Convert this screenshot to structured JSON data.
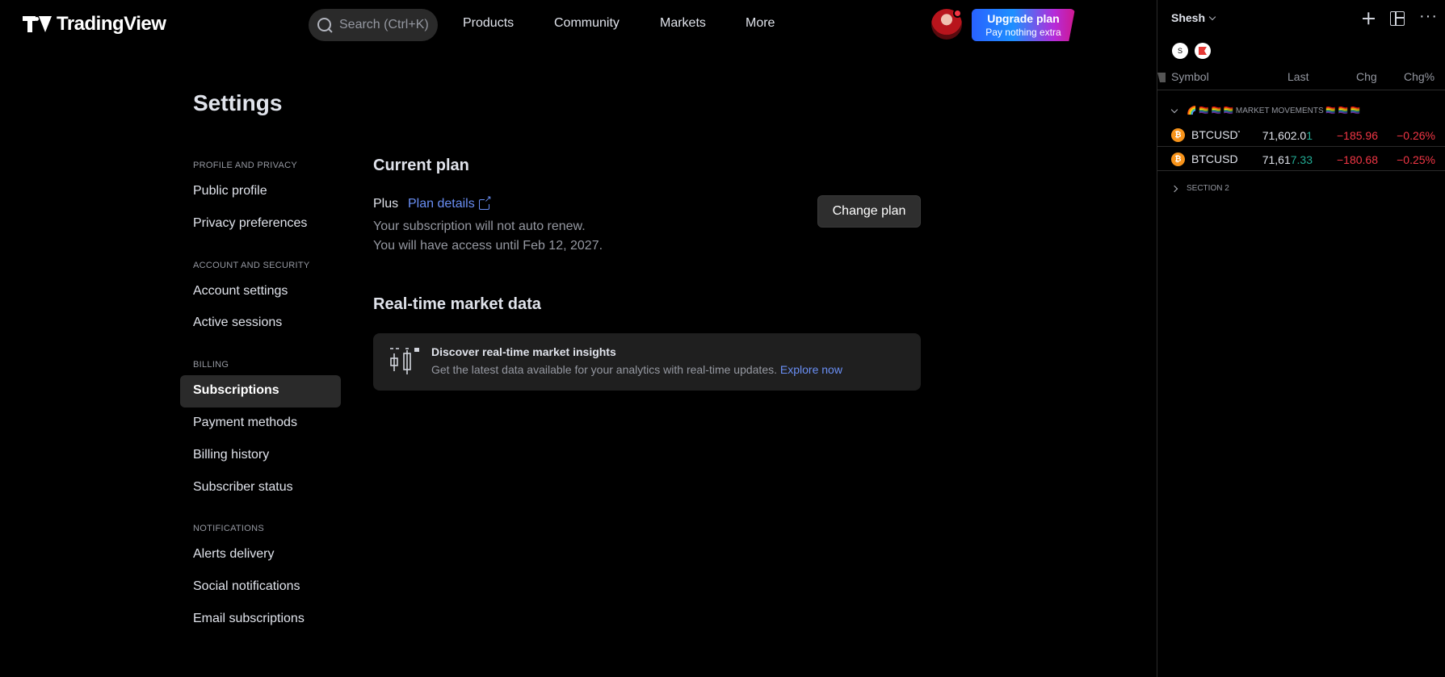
{
  "header": {
    "logo_text": "TradingView",
    "search_placeholder": "Search (Ctrl+K)",
    "nav": [
      "Products",
      "Community",
      "Markets",
      "More"
    ],
    "upgrade_title": "Upgrade plan",
    "upgrade_subtitle": "Pay nothing extra"
  },
  "settings_nav": {
    "title": "Settings",
    "sections": [
      {
        "heading": "PROFILE AND PRIVACY",
        "items": [
          "Public profile",
          "Privacy preferences"
        ]
      },
      {
        "heading": "ACCOUNT AND SECURITY",
        "items": [
          "Account settings",
          "Active sessions"
        ]
      },
      {
        "heading": "BILLING",
        "items": [
          "Subscriptions",
          "Payment methods",
          "Billing history",
          "Subscriber status"
        ]
      },
      {
        "heading": "NOTIFICATIONS",
        "items": [
          "Alerts delivery",
          "Social notifications",
          "Email subscriptions"
        ]
      }
    ],
    "active_item": "Subscriptions"
  },
  "main": {
    "current_plan_heading": "Current plan",
    "plan_name": "Plus",
    "plan_details_link": "Plan details",
    "note_line1": "Your subscription will not auto renew.",
    "note_line2": "You will have access until Feb 12, 2027.",
    "change_plan_button": "Change plan",
    "realtime_heading": "Real-time market data",
    "banner_title": "Discover real-time market insights",
    "banner_text": "Get the latest data available for your analytics with real-time updates.",
    "banner_link": "Explore now"
  },
  "watchlist": {
    "name": "Shesh",
    "badge_s": "S",
    "columns": {
      "symbol": "Symbol",
      "last": "Last",
      "chg": "Chg",
      "chgp": "Chg%"
    },
    "section1": "🌈 🏳️‍🌈 🏳️‍🌈 🏳️‍🌈 MARKET MOVEMENTS 🏳️‍🌈 🏳️‍🌈 🏳️‍🌈",
    "section2": "SECTION 2",
    "rows": [
      {
        "icon": "₿",
        "symbol": "BTCUSDT",
        "last_main": "71,602.0",
        "last_tail": "1",
        "chg": "−185.96",
        "chgp": "−0.26%"
      },
      {
        "icon": "₿",
        "symbol": "BTCUSD",
        "last_main": "71,61",
        "last_tail": "7.33",
        "chg": "−180.68",
        "chgp": "−0.25%"
      }
    ]
  },
  "colors": {
    "background": "#000000",
    "accent_link": "#6a8ff5",
    "negative": "#f23645",
    "positive": "#22ab94",
    "bitcoin": "#f7931a"
  }
}
